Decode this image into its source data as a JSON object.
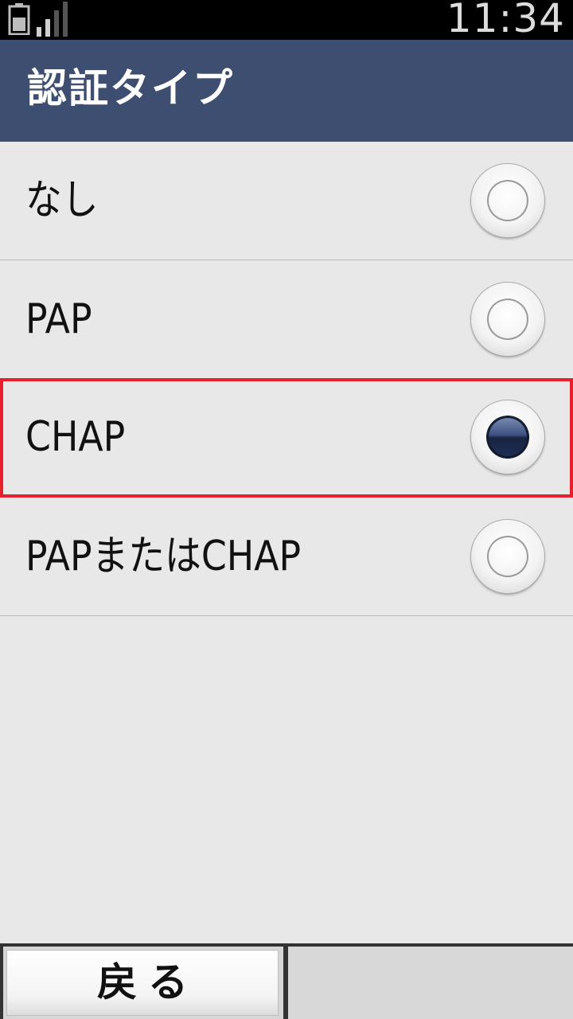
{
  "status_bar": {
    "time": "11:34",
    "battery_icon": "battery-icon",
    "signal_icon": "signal-strength-icon"
  },
  "header": {
    "title": "認証タイプ"
  },
  "options": [
    {
      "label": "なし",
      "selected": false
    },
    {
      "label": "PAP",
      "selected": false
    },
    {
      "label": "CHAP",
      "selected": true
    },
    {
      "label": "PAPまたはCHAP",
      "selected": false
    }
  ],
  "softkeys": {
    "left_label": "戻る",
    "right_label": ""
  },
  "colors": {
    "header_bg": "#3d4e70",
    "focus_border": "#e8202a",
    "list_bg": "#e8e8e8"
  }
}
